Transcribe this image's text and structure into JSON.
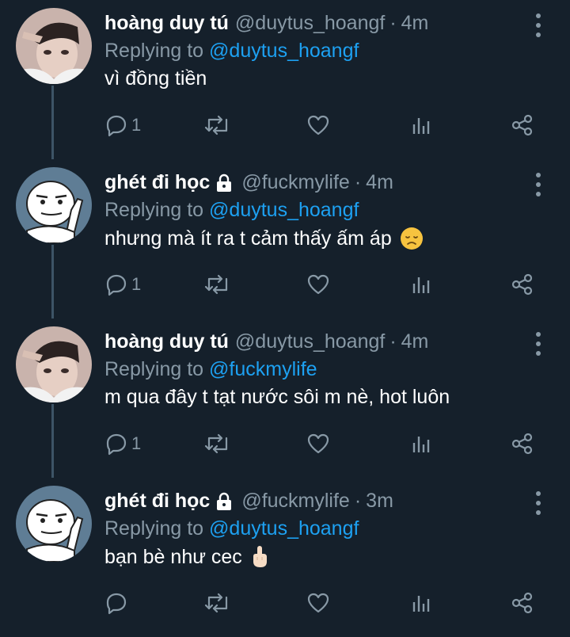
{
  "tweets": [
    {
      "name": "hoàng duy tú",
      "handle": "@duytus_hoangf",
      "dot": "·",
      "time": "4m",
      "replying_prefix": "Replying to ",
      "replying_to": "@duytus_hoangf",
      "text": "vì đồng tiền",
      "reply_count": "1",
      "locked": false,
      "emoji": ""
    },
    {
      "name": "ghét đi học",
      "handle": "@fuckmylife",
      "dot": "·",
      "time": "4m",
      "replying_prefix": "Replying to ",
      "replying_to": "@duytus_hoangf",
      "text": "nhưng mà ít ra t cảm thấy ấm áp",
      "reply_count": "1",
      "locked": true,
      "emoji": "disappointed-face"
    },
    {
      "name": "hoàng duy tú",
      "handle": "@duytus_hoangf",
      "dot": "·",
      "time": "4m",
      "replying_prefix": "Replying to ",
      "replying_to": "@fuckmylife",
      "text": "m qua đây t tạt nước sôi m nè, hot luôn",
      "reply_count": "1",
      "locked": false,
      "emoji": ""
    },
    {
      "name": "ghét đi học",
      "handle": "@fuckmylife",
      "dot": "·",
      "time": "3m",
      "replying_prefix": "Replying to ",
      "replying_to": "@duytus_hoangf",
      "text": "bạn bè như cec",
      "reply_count": "",
      "locked": true,
      "emoji": "middle-finger-hand"
    }
  ],
  "colors": {
    "background": "#15202b",
    "muted": "#8899a6",
    "link": "#1da1f2",
    "thread_line": "#3d5466"
  }
}
